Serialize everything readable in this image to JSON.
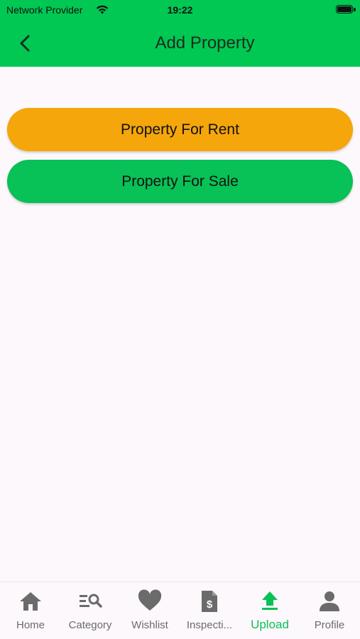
{
  "status_bar": {
    "carrier": "Network Provider",
    "time": "19:22"
  },
  "header": {
    "title": "Add Property",
    "back_icon": "chevron-left-icon"
  },
  "actions": {
    "rent_label": "Property For Rent",
    "sale_label": "Property For Sale",
    "rent_color": "#f5a60b",
    "sale_color": "#08c157"
  },
  "colors": {
    "accent": "#00c853",
    "active_tab": "#08c157",
    "inactive_tab": "#6b6b6b",
    "background": "#fdf8fc"
  },
  "bottom_nav": {
    "active_index": 4,
    "items": [
      {
        "label": "Home",
        "icon": "home-icon"
      },
      {
        "label": "Category",
        "icon": "category-search-icon"
      },
      {
        "label": "Wishlist",
        "icon": "heart-icon"
      },
      {
        "label": "Inspecti...",
        "icon": "document-dollar-icon"
      },
      {
        "label": "Upload",
        "icon": "upload-icon"
      },
      {
        "label": "Profile",
        "icon": "person-icon"
      }
    ]
  }
}
